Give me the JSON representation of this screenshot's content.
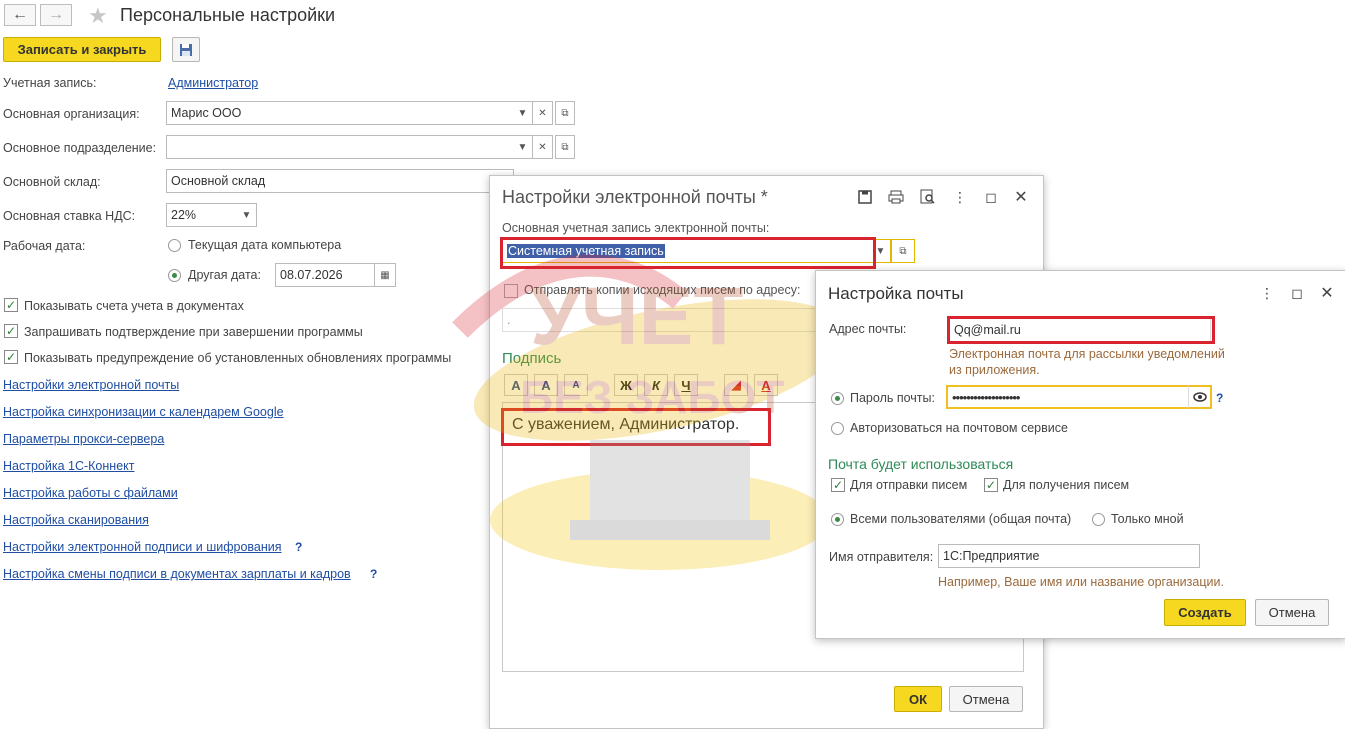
{
  "page": {
    "title": "Персональные настройки",
    "save_close_label": "Записать и закрыть"
  },
  "fields": {
    "account_label": "Учетная запись:",
    "account_value": "Администратор",
    "org_label": "Основная организация:",
    "org_value": "Марис ООО",
    "dept_label": "Основное подразделение:",
    "dept_value": "",
    "warehouse_label": "Основной склад:",
    "warehouse_value": "Основной склад",
    "vat_label": "Основная ставка НДС:",
    "vat_value": "22%",
    "workdate_label": "Рабочая дата:",
    "workdate_opt1": "Текущая дата компьютера",
    "workdate_opt2": "Другая дата:",
    "workdate_value": "08.07.2026"
  },
  "checkboxes": [
    {
      "label": "Показывать счета учета в документах",
      "checked": true
    },
    {
      "label": "Запрашивать подтверждение при завершении программы",
      "checked": true
    },
    {
      "label": "Показывать предупреждение об установленных обновлениях программы",
      "checked": true
    }
  ],
  "links": [
    "Настройки электронной почты",
    "Настройка синхронизации с календарем Google",
    "Параметры прокси-сервера",
    "Настройка 1С-Коннект",
    "Настройка работы с файлами",
    "Настройка сканирования",
    "Настройки электронной подписи и шифрования",
    "Настройка смены подписи в документах зарплаты и кадров"
  ],
  "email_dialog": {
    "title": "Настройки электронной почты *",
    "account_label": "Основная учетная запись электронной почты:",
    "account_value": "Системная учетная запись",
    "copy_label": "Отправлять копии исходящих писем по адресу:",
    "copy_placeholder": ".",
    "signature_title": "Подпись",
    "signature_text": "С уважением, Администратор.",
    "ok_label": "ОК",
    "cancel_label": "Отмена",
    "format_buttons": [
      "A",
      "A",
      "A",
      "Ж",
      "К",
      "Ч",
      "A"
    ]
  },
  "mail_dialog": {
    "title": "Настройка почты",
    "address_label": "Адрес почты:",
    "address_value": "Qq@mail.ru",
    "address_hint_1": "Электронная почта для рассылки уведомлений",
    "address_hint_2": "из приложения.",
    "password_label": "Пароль почты:",
    "password_value": "•••••••••••••••••••",
    "auth_label": "Авторизоваться на почтовом сервисе",
    "usage_title": "Почта будет использоваться",
    "send_label": "Для отправки писем",
    "receive_label": "Для получения писем",
    "all_users_label": "Всеми пользователями (общая почта)",
    "only_me_label": "Только мной",
    "sender_label": "Имя отправителя:",
    "sender_value": "1С:Предприятие",
    "sender_hint": "Например, Ваше имя или название организации.",
    "create_label": "Создать",
    "cancel_label": "Отмена"
  },
  "watermark": {
    "line1": "УЧЕТ",
    "line2": "БЕЗ ЗАБОТ"
  },
  "colors": {
    "accent_yellow": "#f5d81f",
    "highlight_red": "#d9242f",
    "link_blue": "#1f4ea3",
    "section_green": "#2e8b57"
  }
}
